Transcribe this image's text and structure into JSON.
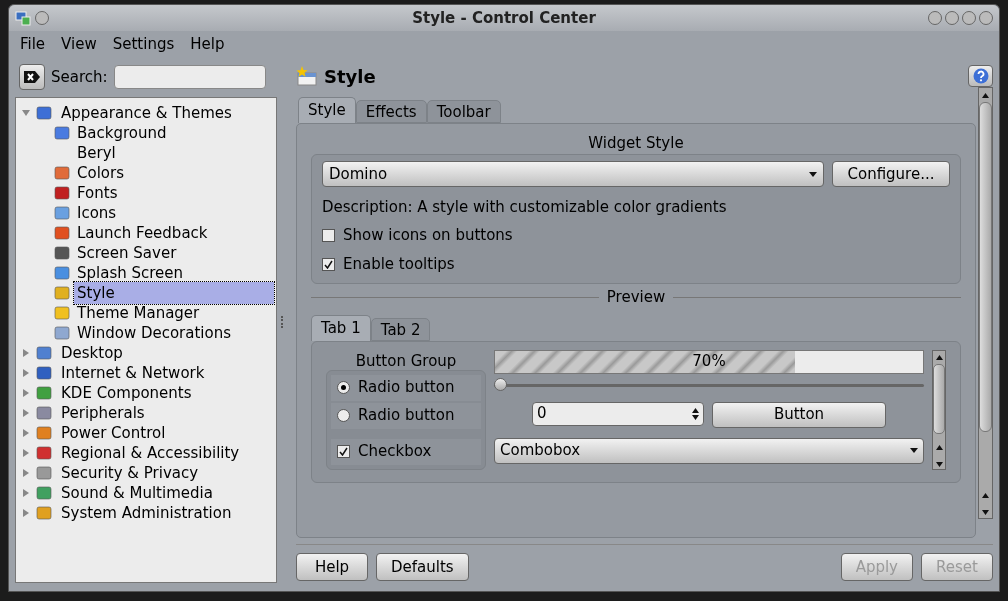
{
  "window": {
    "title": "Style - Control Center"
  },
  "menu": [
    "File",
    "View",
    "Settings",
    "Help"
  ],
  "search": {
    "label": "Search:"
  },
  "tree": [
    {
      "label": "Appearance & Themes",
      "expanded": true,
      "selected": false,
      "children": [
        {
          "label": "Background",
          "selected": false
        },
        {
          "label": "Beryl",
          "selected": false
        },
        {
          "label": "Colors",
          "selected": false
        },
        {
          "label": "Fonts",
          "selected": false
        },
        {
          "label": "Icons",
          "selected": false
        },
        {
          "label": "Launch Feedback",
          "selected": false
        },
        {
          "label": "Screen Saver",
          "selected": false
        },
        {
          "label": "Splash Screen",
          "selected": false
        },
        {
          "label": "Style",
          "selected": true
        },
        {
          "label": "Theme Manager",
          "selected": false
        },
        {
          "label": "Window Decorations",
          "selected": false
        }
      ]
    },
    {
      "label": "Desktop",
      "expanded": false,
      "selected": false
    },
    {
      "label": "Internet & Network",
      "expanded": false,
      "selected": false
    },
    {
      "label": "KDE Components",
      "expanded": false,
      "selected": false
    },
    {
      "label": "Peripherals",
      "expanded": false,
      "selected": false
    },
    {
      "label": "Power Control",
      "expanded": false,
      "selected": false
    },
    {
      "label": "Regional & Accessibility",
      "expanded": false,
      "selected": false
    },
    {
      "label": "Security & Privacy",
      "expanded": false,
      "selected": false
    },
    {
      "label": "Sound & Multimedia",
      "expanded": false,
      "selected": false
    },
    {
      "label": "System Administration",
      "expanded": false,
      "selected": false
    }
  ],
  "page": {
    "title": "Style",
    "tabs": [
      {
        "label": "Style",
        "selected": true
      },
      {
        "label": "Effects",
        "selected": false
      },
      {
        "label": "Toolbar",
        "selected": false
      }
    ],
    "widget_style": {
      "heading": "Widget Style",
      "combobox": "Domino",
      "configure": "Configure...",
      "description": "Description: A style with customizable color gradients",
      "checkboxes": [
        {
          "label": "Show icons on buttons",
          "checked": false
        },
        {
          "label": "Enable tooltips",
          "checked": true
        }
      ]
    },
    "preview": {
      "heading": "Preview",
      "tabs": [
        {
          "label": "Tab 1",
          "selected": true
        },
        {
          "label": "Tab 2",
          "selected": false
        }
      ],
      "button_group": {
        "heading": "Button Group",
        "items": [
          {
            "kind": "radio",
            "label": "Radio button",
            "checked": true
          },
          {
            "kind": "radio",
            "label": "Radio button",
            "checked": false
          },
          {
            "kind": "checkbox",
            "label": "Checkbox",
            "checked": true
          }
        ]
      },
      "progress": {
        "level": 0.7,
        "reading": "70%"
      },
      "slider": {
        "level": 0
      },
      "spinbox": "0",
      "button": "Button",
      "combobox": "Combobox"
    }
  },
  "buttons": [
    {
      "label": "Help",
      "disabled": false
    },
    {
      "label": "Defaults",
      "disabled": false
    },
    {
      "label": "Apply",
      "disabled": true
    },
    {
      "label": "Reset",
      "disabled": true
    }
  ]
}
